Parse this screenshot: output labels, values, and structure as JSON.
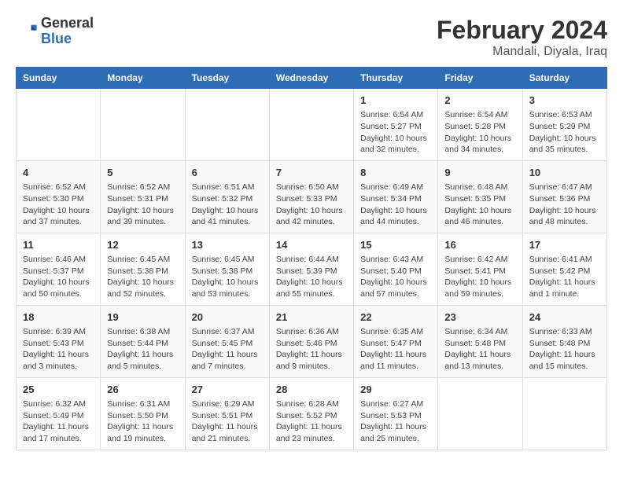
{
  "header": {
    "logo_line1": "General",
    "logo_line2": "Blue",
    "title": "February 2024",
    "subtitle": "Mandali, Diyala, Iraq"
  },
  "days_of_week": [
    "Sunday",
    "Monday",
    "Tuesday",
    "Wednesday",
    "Thursday",
    "Friday",
    "Saturday"
  ],
  "weeks": [
    [
      {
        "day": "",
        "info": ""
      },
      {
        "day": "",
        "info": ""
      },
      {
        "day": "",
        "info": ""
      },
      {
        "day": "",
        "info": ""
      },
      {
        "day": "1",
        "info": "Sunrise: 6:54 AM\nSunset: 5:27 PM\nDaylight: 10 hours\nand 32 minutes."
      },
      {
        "day": "2",
        "info": "Sunrise: 6:54 AM\nSunset: 5:28 PM\nDaylight: 10 hours\nand 34 minutes."
      },
      {
        "day": "3",
        "info": "Sunrise: 6:53 AM\nSunset: 5:29 PM\nDaylight: 10 hours\nand 35 minutes."
      }
    ],
    [
      {
        "day": "4",
        "info": "Sunrise: 6:52 AM\nSunset: 5:30 PM\nDaylight: 10 hours\nand 37 minutes."
      },
      {
        "day": "5",
        "info": "Sunrise: 6:52 AM\nSunset: 5:31 PM\nDaylight: 10 hours\nand 39 minutes."
      },
      {
        "day": "6",
        "info": "Sunrise: 6:51 AM\nSunset: 5:32 PM\nDaylight: 10 hours\nand 41 minutes."
      },
      {
        "day": "7",
        "info": "Sunrise: 6:50 AM\nSunset: 5:33 PM\nDaylight: 10 hours\nand 42 minutes."
      },
      {
        "day": "8",
        "info": "Sunrise: 6:49 AM\nSunset: 5:34 PM\nDaylight: 10 hours\nand 44 minutes."
      },
      {
        "day": "9",
        "info": "Sunrise: 6:48 AM\nSunset: 5:35 PM\nDaylight: 10 hours\nand 46 minutes."
      },
      {
        "day": "10",
        "info": "Sunrise: 6:47 AM\nSunset: 5:36 PM\nDaylight: 10 hours\nand 48 minutes."
      }
    ],
    [
      {
        "day": "11",
        "info": "Sunrise: 6:46 AM\nSunset: 5:37 PM\nDaylight: 10 hours\nand 50 minutes."
      },
      {
        "day": "12",
        "info": "Sunrise: 6:45 AM\nSunset: 5:38 PM\nDaylight: 10 hours\nand 52 minutes."
      },
      {
        "day": "13",
        "info": "Sunrise: 6:45 AM\nSunset: 5:38 PM\nDaylight: 10 hours\nand 53 minutes."
      },
      {
        "day": "14",
        "info": "Sunrise: 6:44 AM\nSunset: 5:39 PM\nDaylight: 10 hours\nand 55 minutes."
      },
      {
        "day": "15",
        "info": "Sunrise: 6:43 AM\nSunset: 5:40 PM\nDaylight: 10 hours\nand 57 minutes."
      },
      {
        "day": "16",
        "info": "Sunrise: 6:42 AM\nSunset: 5:41 PM\nDaylight: 10 hours\nand 59 minutes."
      },
      {
        "day": "17",
        "info": "Sunrise: 6:41 AM\nSunset: 5:42 PM\nDaylight: 11 hours\nand 1 minute."
      }
    ],
    [
      {
        "day": "18",
        "info": "Sunrise: 6:39 AM\nSunset: 5:43 PM\nDaylight: 11 hours\nand 3 minutes."
      },
      {
        "day": "19",
        "info": "Sunrise: 6:38 AM\nSunset: 5:44 PM\nDaylight: 11 hours\nand 5 minutes."
      },
      {
        "day": "20",
        "info": "Sunrise: 6:37 AM\nSunset: 5:45 PM\nDaylight: 11 hours\nand 7 minutes."
      },
      {
        "day": "21",
        "info": "Sunrise: 6:36 AM\nSunset: 5:46 PM\nDaylight: 11 hours\nand 9 minutes."
      },
      {
        "day": "22",
        "info": "Sunrise: 6:35 AM\nSunset: 5:47 PM\nDaylight: 11 hours\nand 11 minutes."
      },
      {
        "day": "23",
        "info": "Sunrise: 6:34 AM\nSunset: 5:48 PM\nDaylight: 11 hours\nand 13 minutes."
      },
      {
        "day": "24",
        "info": "Sunrise: 6:33 AM\nSunset: 5:48 PM\nDaylight: 11 hours\nand 15 minutes."
      }
    ],
    [
      {
        "day": "25",
        "info": "Sunrise: 6:32 AM\nSunset: 5:49 PM\nDaylight: 11 hours\nand 17 minutes."
      },
      {
        "day": "26",
        "info": "Sunrise: 6:31 AM\nSunset: 5:50 PM\nDaylight: 11 hours\nand 19 minutes."
      },
      {
        "day": "27",
        "info": "Sunrise: 6:29 AM\nSunset: 5:51 PM\nDaylight: 11 hours\nand 21 minutes."
      },
      {
        "day": "28",
        "info": "Sunrise: 6:28 AM\nSunset: 5:52 PM\nDaylight: 11 hours\nand 23 minutes."
      },
      {
        "day": "29",
        "info": "Sunrise: 6:27 AM\nSunset: 5:53 PM\nDaylight: 11 hours\nand 25 minutes."
      },
      {
        "day": "",
        "info": ""
      },
      {
        "day": "",
        "info": ""
      }
    ]
  ]
}
